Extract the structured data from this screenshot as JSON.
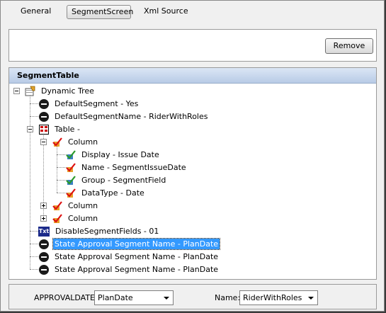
{
  "tabs": [
    {
      "label": "General",
      "active": false
    },
    {
      "label": "SegmentScreen",
      "active": true
    },
    {
      "label": "Xml Source",
      "active": false
    }
  ],
  "toolbar": {
    "remove_label": "Remove"
  },
  "segment_table": {
    "title": "SegmentTable",
    "tree": {
      "root": "Dynamic Tree",
      "default_segment": "DefaultSegment - Yes",
      "default_segment_name": "DefaultSegmentName - RiderWithRoles",
      "table": "Table -",
      "column_1": "Column",
      "display": "Display - Issue Date",
      "name": "Name - SegmentIssueDate",
      "group": "Group - SegmentField",
      "datatype": "DataType - Date",
      "column_2": "Column",
      "column_3": "Column",
      "disable_segment_fields": "DisableSegmentFields - 01",
      "state_approval_1": "State Approval Segment Name - PlanDate",
      "state_approval_2": "State Approval Segment Name - PlanDate",
      "state_approval_3": "State Approval Segment Name - PlanDate"
    },
    "icons": {
      "txt_badge": "Txt"
    }
  },
  "bottom": {
    "approvaldate_label": "APPROVALDATE:",
    "approvaldate_value": "PlanDate",
    "name_label": "Name:",
    "name_value": "RiderWithRoles"
  },
  "colors": {
    "header_gradient_top": "#dbe6f5",
    "header_gradient_bottom": "#b8cbe6",
    "selection": "#3399ff",
    "txt_icon": "#1b2a8a"
  }
}
